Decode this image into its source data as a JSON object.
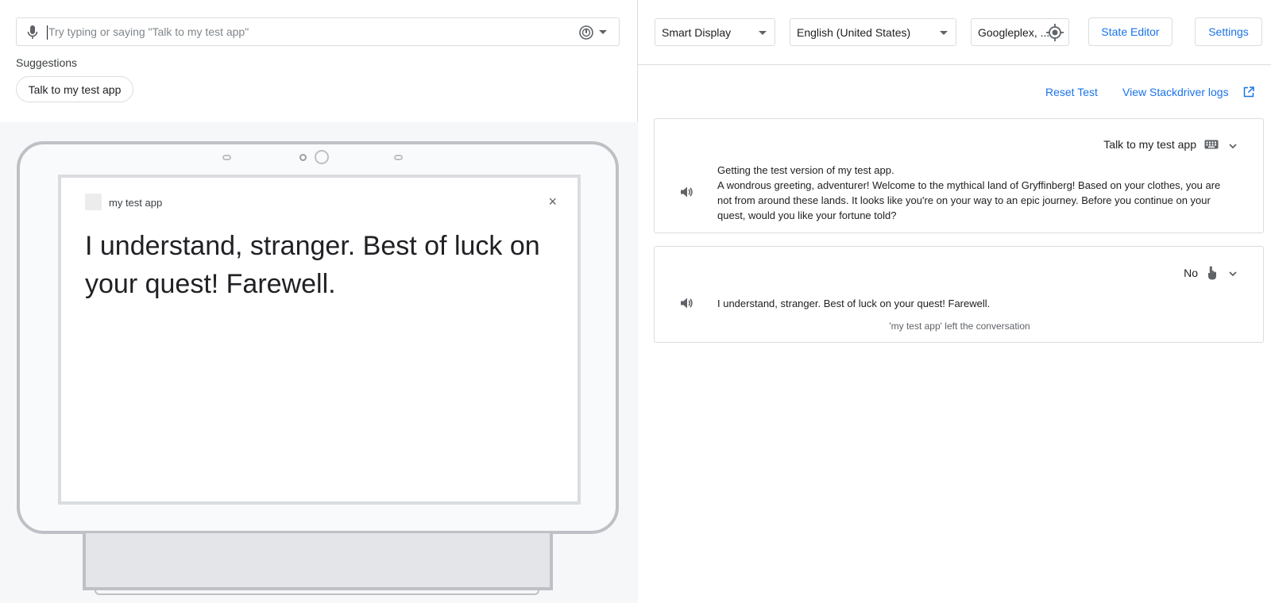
{
  "input": {
    "placeholder": "Try typing or saying \"Talk to my test app\""
  },
  "suggestions": {
    "label": "Suggestions",
    "chips": [
      "Talk to my test app"
    ]
  },
  "device": {
    "app_name": "my test app",
    "close_glyph": "×",
    "display_text": "I understand, stranger. Best of luck on your quest! Farewell."
  },
  "toolbar": {
    "surface": "Smart Display",
    "language": "English (United States)",
    "location": "Googleplex, ...",
    "state_editor": "State Editor",
    "settings": "Settings"
  },
  "links": {
    "reset": "Reset Test",
    "logs": "View Stackdriver logs"
  },
  "conversation": [
    {
      "user_input": "Talk to my test app",
      "input_icon": "keyboard-icon",
      "response_lines": [
        "Getting the test version of my test app.",
        "A wondrous greeting, adventurer! Welcome to the mythical land of Gryffinberg! Based on your clothes, you are not from around these lands. It looks like you're on your way to an epic journey. Before you continue on your quest, would you like your fortune told?"
      ]
    },
    {
      "user_input": "No",
      "input_icon": "touch-icon",
      "response_lines": [
        "I understand, stranger. Best of luck on your quest! Farewell."
      ],
      "note": "'my test app' left the conversation"
    }
  ],
  "colors": {
    "accent": "#1a73e8",
    "border": "#dadce0",
    "stage_bg": "#f6f7f9",
    "device_frame": "#bdc1c6"
  }
}
